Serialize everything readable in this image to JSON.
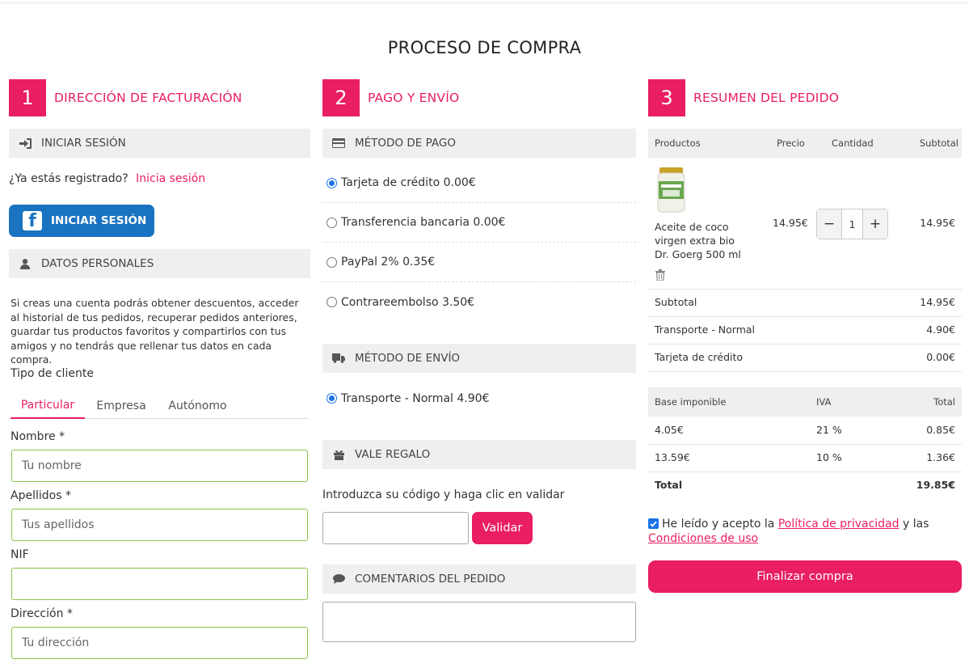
{
  "page_title": "PROCESO DE COMPRA",
  "accent_color": "#e91e63",
  "steps": [
    {
      "num": "1",
      "title": "DIRECCIÓN DE FACTURACIÓN"
    },
    {
      "num": "2",
      "title": "PAGO Y ENVÍO"
    },
    {
      "num": "3",
      "title": "RESUMEN DEL PEDIDO"
    }
  ],
  "billing": {
    "login_bar": {
      "label": "INICIAR SESIÓN",
      "icon": "sign-in-icon"
    },
    "registered_text": "¿Ya estás registrado?",
    "login_link": "Inicia sesión",
    "facebook_button": "INICIAR SESIÓN",
    "personal_bar": {
      "label": "DATOS PERSONALES",
      "icon": "user-icon"
    },
    "info_text": "Si creas una cuenta podrás obtener descuentos, acceder al historial de tus pedidos, recuperar pedidos anteriores, guardar tus productos favoritos y compartirlos con tus amigos y no tendrás que rellenar tus datos en cada compra.",
    "client_type_label": "Tipo de cliente",
    "client_tabs": [
      "Particular",
      "Empresa",
      "Autónomo"
    ],
    "fields": [
      {
        "label": "Nombre *",
        "placeholder": "Tu nombre"
      },
      {
        "label": "Apellidos *",
        "placeholder": "Tus apellidos"
      },
      {
        "label": "NIF",
        "placeholder": ""
      },
      {
        "label": "Dirección *",
        "placeholder": "Tu dirección"
      }
    ]
  },
  "payment": {
    "method_bar": {
      "label": "MÉTODO DE PAGO",
      "icon": "credit-card-icon"
    },
    "methods": [
      {
        "label": "Tarjeta de crédito 0.00€",
        "selected": true
      },
      {
        "label": "Transferencia bancaria 0.00€",
        "selected": false
      },
      {
        "label": "PayPal 2% 0.35€",
        "selected": false
      },
      {
        "label": "Contrareembolso 3.50€",
        "selected": false
      }
    ],
    "shipping_bar": {
      "label": "MÉTODO DE ENVÍO",
      "icon": "truck-icon"
    },
    "shipping": [
      {
        "label": "Transporte - Normal 4.90€",
        "selected": true
      }
    ],
    "gift_bar": {
      "label": "VALE REGALO",
      "icon": "gift-icon"
    },
    "gift_text": "Introduzca su código y haga clic en validar",
    "validate_button": "Validar",
    "comments_bar": {
      "label": "COMENTARIOS DEL PEDIDO",
      "icon": "comment-icon"
    }
  },
  "summary": {
    "headers": {
      "product": "Productos",
      "price": "Precio",
      "qty": "Cantidad",
      "subtotal": "Subtotal"
    },
    "product": {
      "name": "Aceite de coco virgen extra bio Dr. Goerg 500 ml",
      "price": "14.95€",
      "qty": "1",
      "subtotal": "14.95€",
      "qty_minus": "−",
      "qty_plus": "+"
    },
    "totals": [
      {
        "label": "Subtotal",
        "value": "14.95€"
      },
      {
        "label": "Transporte - Normal",
        "value": "4.90€"
      },
      {
        "label": "Tarjeta de crédito",
        "value": "0.00€"
      }
    ],
    "tax_headers": {
      "base": "Base imponible",
      "iva": "IVA",
      "total": "Total"
    },
    "tax_rows": [
      {
        "base": "4.05€",
        "iva": "21 %",
        "total": "0.85€"
      },
      {
        "base": "13.59€",
        "iva": "10 %",
        "total": "1.36€"
      }
    ],
    "grand_total": {
      "label": "Total",
      "value": "19.85€"
    },
    "legal": {
      "prefix": "He leído y acepto la",
      "privacy": "Política de privacidad",
      "middle": "y las",
      "terms": "Condiciones de uso",
      "checked": true
    },
    "finish_button": "Finalizar compra"
  }
}
